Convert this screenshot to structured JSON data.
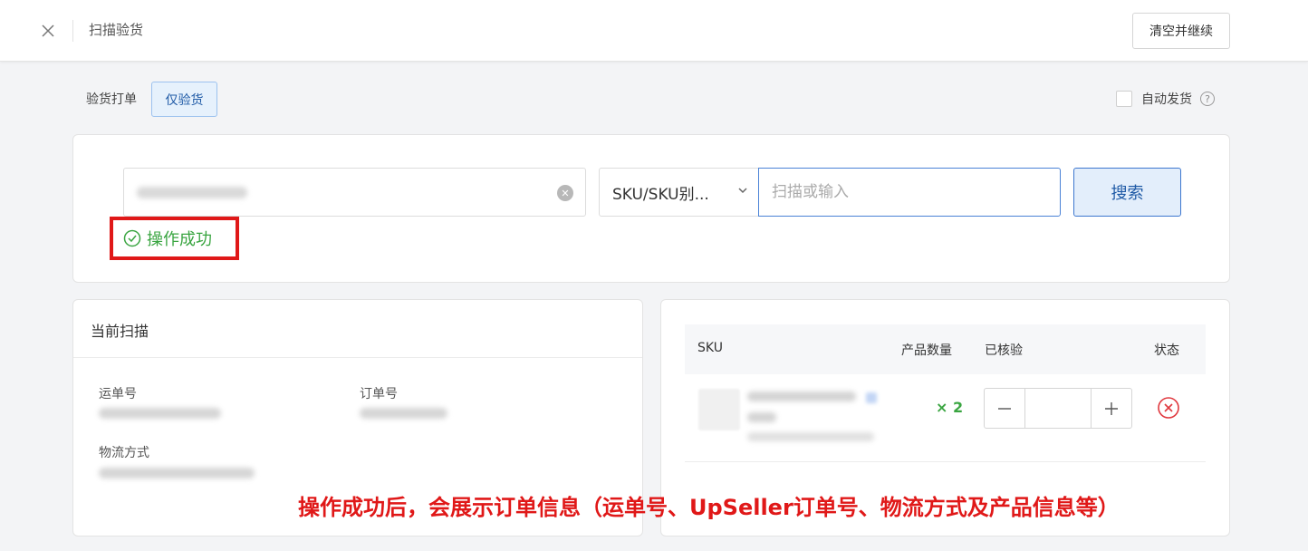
{
  "header": {
    "title": "扫描验货",
    "clear_continue_label": "清空并继续"
  },
  "mode": {
    "label": "验货打单",
    "active_option": "仅验货"
  },
  "auto_ship": {
    "label": "自动发货",
    "checked": false,
    "help": "?"
  },
  "search": {
    "scan_value": "",
    "field_type": "SKU/SKU别...",
    "placeholder": "扫描或输入",
    "button_label": "搜索",
    "success_message": "操作成功"
  },
  "current_scan": {
    "title": "当前扫描",
    "tracking_label": "运单号",
    "order_label": "订单号",
    "logistics_label": "物流方式"
  },
  "sku_table": {
    "columns": [
      "SKU",
      "产品数量",
      "已核验",
      "状态"
    ],
    "rows": [
      {
        "quantity": "× 2",
        "verified": ""
      }
    ]
  },
  "annotation": "操作成功后，会展示订单信息（运单号、UpSeller订单号、物流方式及产品信息等）",
  "colors": {
    "success": "#3aa541",
    "primary": "#3d77cf",
    "highlight_red": "#e01818"
  }
}
